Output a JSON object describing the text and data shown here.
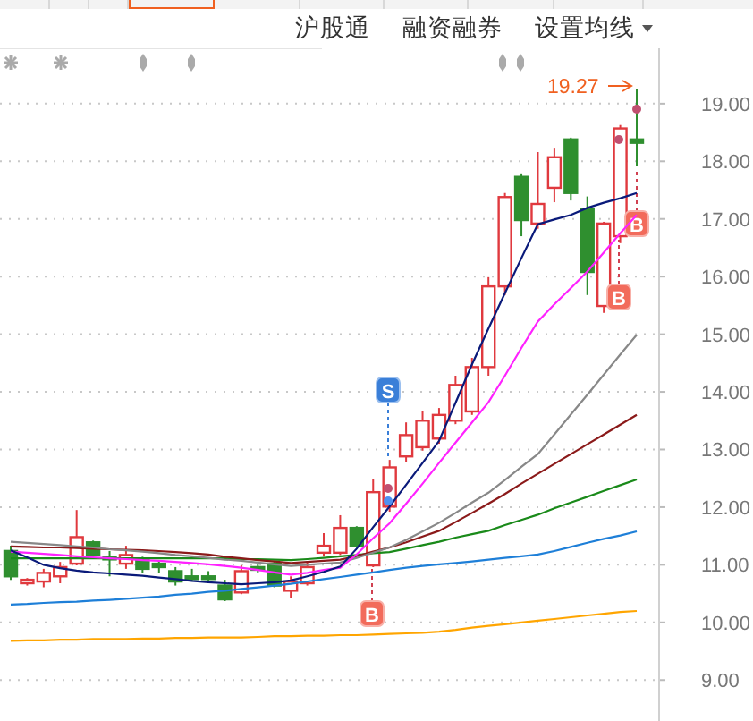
{
  "tab_strip": [
    {
      "selected": false
    },
    {
      "selected": false
    },
    {
      "selected": false
    },
    {
      "selected": true
    },
    {
      "selected": false
    },
    {
      "selected": false
    },
    {
      "selected": false
    },
    {
      "selected": false
    },
    {
      "selected": false
    }
  ],
  "toolbar": [
    {
      "label": "沪股通",
      "kind": "link"
    },
    {
      "label": "融资融券",
      "kind": "link"
    },
    {
      "label": "设置均线",
      "kind": "dropdown"
    }
  ],
  "chart": {
    "chart_data": {
      "type": "candlestick",
      "ylim": [
        8.29,
        19.96
      ],
      "grid": true,
      "categories": [
        null,
        null,
        null,
        null,
        null,
        null,
        null,
        null,
        null,
        null,
        null,
        null,
        null,
        null,
        null,
        null,
        null,
        null,
        null,
        null,
        null,
        null,
        null,
        null,
        null,
        null,
        null,
        null,
        null,
        null,
        null,
        null,
        null,
        null,
        null,
        null,
        null,
        null,
        null
      ],
      "yticks": [
        {
          "value": 19,
          "label": "19.00"
        },
        {
          "value": 18,
          "label": "18.00"
        },
        {
          "value": 17,
          "label": "17.00"
        },
        {
          "value": 16,
          "label": "16.00"
        },
        {
          "value": 15,
          "label": "15.00"
        },
        {
          "value": 14,
          "label": "14.00"
        },
        {
          "value": 13,
          "label": "13.00"
        },
        {
          "value": 12,
          "label": "12.00"
        },
        {
          "value": 11,
          "label": "11.00"
        },
        {
          "value": 10,
          "label": "10.00"
        },
        {
          "value": 9,
          "label": "9.00"
        }
      ],
      "ohlc": [
        [
          11.24,
          11.33,
          10.74,
          10.8
        ],
        [
          10.68,
          10.77,
          10.64,
          10.74
        ],
        [
          10.71,
          10.93,
          10.61,
          10.86
        ],
        [
          10.8,
          11.05,
          10.68,
          10.96
        ],
        [
          11.02,
          11.95,
          10.99,
          11.48
        ],
        [
          11.39,
          11.42,
          11.11,
          11.17
        ],
        [
          11.14,
          11.24,
          10.8,
          11.11
        ],
        [
          11.02,
          11.33,
          10.93,
          11.17
        ],
        [
          11.08,
          11.14,
          10.86,
          10.93
        ],
        [
          11.02,
          11.08,
          10.86,
          10.96
        ],
        [
          10.89,
          10.96,
          10.64,
          10.71
        ],
        [
          10.8,
          10.93,
          10.71,
          10.77
        ],
        [
          10.8,
          10.89,
          10.68,
          10.77
        ],
        [
          10.64,
          10.74,
          10.37,
          10.4
        ],
        [
          10.52,
          10.99,
          10.49,
          10.89
        ],
        [
          10.96,
          11.02,
          10.86,
          10.93
        ],
        [
          11.02,
          11.05,
          10.61,
          10.64
        ],
        [
          10.55,
          10.8,
          10.43,
          10.71
        ],
        [
          10.68,
          11.05,
          10.64,
          10.96
        ],
        [
          11.21,
          11.55,
          11.14,
          11.33
        ],
        [
          11.21,
          11.86,
          11.17,
          11.64
        ],
        [
          11.64,
          11.67,
          11.3,
          11.33
        ],
        [
          10.99,
          12.48,
          10.96,
          12.26
        ],
        [
          12.01,
          12.82,
          11.92,
          12.69
        ],
        [
          12.88,
          13.47,
          12.79,
          13.25
        ],
        [
          13.04,
          13.66,
          12.98,
          13.5
        ],
        [
          13.19,
          13.72,
          13.1,
          13.6
        ],
        [
          13.5,
          14.28,
          13.44,
          14.12
        ],
        [
          13.66,
          14.59,
          13.6,
          14.43
        ],
        [
          14.43,
          15.99,
          14.28,
          15.83
        ],
        [
          15.83,
          17.45,
          15.68,
          17.38
        ],
        [
          17.73,
          17.79,
          16.7,
          16.98
        ],
        [
          16.92,
          18.16,
          16.83,
          17.26
        ],
        [
          17.54,
          18.22,
          17.29,
          18.07
        ],
        [
          18.38,
          18.41,
          17.32,
          17.45
        ],
        [
          17.17,
          17.39,
          15.68,
          16.08
        ],
        [
          15.49,
          16.95,
          15.37,
          16.92
        ],
        [
          16.7,
          18.63,
          16.58,
          18.57
        ],
        [
          18.38,
          19.25,
          17.91,
          18.32
        ]
      ],
      "series": [
        {
          "type": "line",
          "color": "#ffa500",
          "values": [
            9.68,
            9.69,
            9.69,
            9.7,
            9.7,
            9.71,
            9.71,
            9.71,
            9.72,
            9.72,
            9.73,
            9.73,
            9.74,
            9.74,
            9.74,
            9.75,
            9.76,
            9.76,
            9.77,
            9.77,
            9.78,
            9.78,
            9.79,
            9.8,
            9.81,
            9.82,
            9.84,
            9.87,
            9.91,
            9.94,
            9.97,
            10.0,
            10.03,
            10.06,
            10.09,
            10.12,
            10.15,
            10.18,
            10.2
          ]
        },
        {
          "type": "line",
          "color": "#1e7fd8",
          "values": [
            10.31,
            10.32,
            10.34,
            10.35,
            10.36,
            10.38,
            10.39,
            10.41,
            10.43,
            10.45,
            10.48,
            10.5,
            10.53,
            10.55,
            10.58,
            10.61,
            10.64,
            10.67,
            10.71,
            10.75,
            10.79,
            10.83,
            10.87,
            10.91,
            10.95,
            10.98,
            11.01,
            11.03,
            11.06,
            11.09,
            11.12,
            11.15,
            11.18,
            11.24,
            11.31,
            11.38,
            11.45,
            11.51,
            11.58
          ]
        },
        {
          "type": "line",
          "color": "#1a8a1a",
          "values": [
            11.11,
            11.11,
            11.11,
            11.11,
            11.11,
            11.11,
            11.11,
            11.11,
            11.11,
            11.11,
            11.11,
            11.11,
            11.11,
            11.11,
            11.1,
            11.1,
            11.09,
            11.08,
            11.1,
            11.12,
            11.15,
            11.17,
            11.2,
            11.22,
            11.28,
            11.34,
            11.4,
            11.47,
            11.53,
            11.59,
            11.69,
            11.78,
            11.87,
            11.98,
            12.08,
            12.18,
            12.28,
            12.38,
            12.48
          ]
        },
        {
          "type": "line",
          "color": "#8b1a1a",
          "values": [
            11.32,
            11.31,
            11.3,
            11.3,
            11.29,
            11.28,
            11.27,
            11.26,
            11.25,
            11.24,
            11.22,
            11.2,
            11.18,
            11.14,
            11.11,
            11.08,
            11.06,
            11.03,
            11.05,
            11.07,
            11.09,
            11.15,
            11.23,
            11.3,
            11.39,
            11.49,
            11.59,
            11.74,
            11.9,
            12.06,
            12.23,
            12.41,
            12.58,
            12.75,
            12.92,
            13.09,
            13.26,
            13.43,
            13.6
          ]
        },
        {
          "type": "line",
          "color": "#888888",
          "values": [
            11.4,
            11.38,
            11.36,
            11.34,
            11.32,
            11.3,
            11.27,
            11.25,
            11.23,
            11.2,
            11.17,
            11.15,
            11.12,
            11.09,
            11.07,
            11.04,
            11.01,
            10.98,
            11.0,
            11.02,
            11.04,
            11.12,
            11.21,
            11.3,
            11.43,
            11.58,
            11.73,
            11.9,
            12.08,
            12.25,
            12.47,
            12.7,
            12.92,
            13.26,
            13.61,
            13.95,
            14.3,
            14.65,
            14.99
          ]
        },
        {
          "type": "line",
          "color": "#ff22ff",
          "values": [
            11.23,
            11.21,
            11.19,
            11.17,
            11.15,
            11.13,
            11.11,
            11.1,
            11.08,
            11.07,
            11.05,
            11.03,
            11.01,
            10.98,
            10.95,
            10.91,
            10.87,
            10.83,
            10.86,
            10.91,
            10.95,
            11.18,
            11.46,
            11.72,
            12.06,
            12.41,
            12.77,
            13.12,
            13.47,
            13.82,
            14.28,
            14.76,
            15.22,
            15.52,
            15.8,
            16.09,
            16.42,
            16.75,
            17.07
          ]
        },
        {
          "type": "line",
          "color": "#0a1a7a",
          "values": [
            11.25,
            11.13,
            11.0,
            10.94,
            10.9,
            10.87,
            10.85,
            10.83,
            10.81,
            10.78,
            10.75,
            10.72,
            10.7,
            10.68,
            10.66,
            10.68,
            10.7,
            10.73,
            10.8,
            10.88,
            10.97,
            11.28,
            11.65,
            12.01,
            12.39,
            12.77,
            13.15,
            13.81,
            14.48,
            15.1,
            15.71,
            16.32,
            16.91,
            16.99,
            17.07,
            17.19,
            17.28,
            17.36,
            17.45
          ]
        }
      ]
    },
    "markers": [
      {
        "kind": "price",
        "text": "19.27"
      },
      {
        "kind": "sell",
        "text": "S"
      },
      {
        "kind": "buy",
        "text": "B"
      },
      {
        "kind": "buy",
        "text": "B"
      },
      {
        "kind": "buy",
        "text": "B"
      }
    ]
  }
}
